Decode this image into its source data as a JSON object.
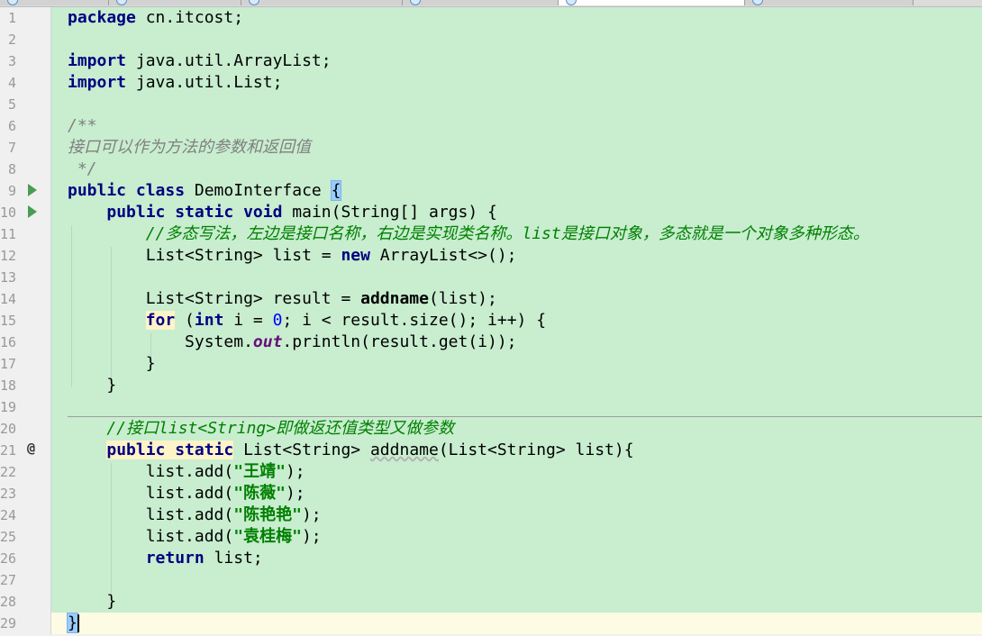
{
  "editor": {
    "line_numbers": [
      "1",
      "2",
      "3",
      "4",
      "5",
      "6",
      "7",
      "8",
      "9",
      "10",
      "11",
      "12",
      "13",
      "14",
      "15",
      "16",
      "17",
      "18",
      "19",
      "20",
      "21",
      "22",
      "23",
      "24",
      "25",
      "26",
      "27",
      "28",
      "29"
    ],
    "gutter_markers": {
      "override_symbol": "@"
    },
    "lines": {
      "l1": {
        "kw": "package",
        "rest": " cn.itcost;"
      },
      "l3": {
        "kw": "import",
        "rest": " java.util.ArrayList;"
      },
      "l4": {
        "kw": "import",
        "rest": " java.util.List;"
      },
      "l6": "/**",
      "l7": "接口可以作为方法的参数和返回值",
      "l8": " */",
      "l9": {
        "kw": "public class",
        "name": " DemoInterface ",
        "brace": "{"
      },
      "l10": {
        "kw": "public static void",
        "rest": " main(String[] args) {"
      },
      "l11": "//多态写法，左边是接口名称，右边是实现类名称。list是接口对象，多态就是一个对象多种形态。",
      "l12": {
        "a": "List<String> list = ",
        "kw": "new",
        "b": " ArrayList<>();"
      },
      "l14": {
        "a": "List<String> result = ",
        "method": "addname",
        "b": "(list);"
      },
      "l15": {
        "kw_for": "for",
        "a": " (",
        "kw_int": "int",
        "b": " i = ",
        "num": "0",
        "c": "; i < result.size(); i++) {"
      },
      "l16": {
        "a": "System.",
        "field": "out",
        "b": ".println(result.get(i));"
      },
      "l17": "}",
      "l18": "}",
      "l20": "//接口list<String>即做返还值类型又做参数",
      "l21": {
        "kw": "public static",
        "a": " List<String> ",
        "method": "addname",
        "b": "(List<String> list){"
      },
      "l22": {
        "a": "list.add(",
        "str": "\"王靖\"",
        "b": ");"
      },
      "l23": {
        "a": "list.add(",
        "str": "\"陈薇\"",
        "b": ");"
      },
      "l24": {
        "a": "list.add(",
        "str": "\"陈艳艳\"",
        "b": ");"
      },
      "l25": {
        "a": "list.add(",
        "str": "\"袁桂梅\"",
        "b": ");"
      },
      "l26": {
        "kw": "return",
        "rest": " list;"
      },
      "l28": "}",
      "l29": "}"
    }
  },
  "colors": {
    "editor_bg": "#c8edcf",
    "current_line_bg": "#fdfbe3",
    "keyword": "#000080",
    "string": "#008000",
    "comment_green": "#008000",
    "comment_gray": "#808080",
    "number": "#0000ff",
    "field": "#660e7a"
  },
  "icons": [
    "run-icon",
    "fold-icon",
    "override-icon",
    "file-tab-icon"
  ]
}
